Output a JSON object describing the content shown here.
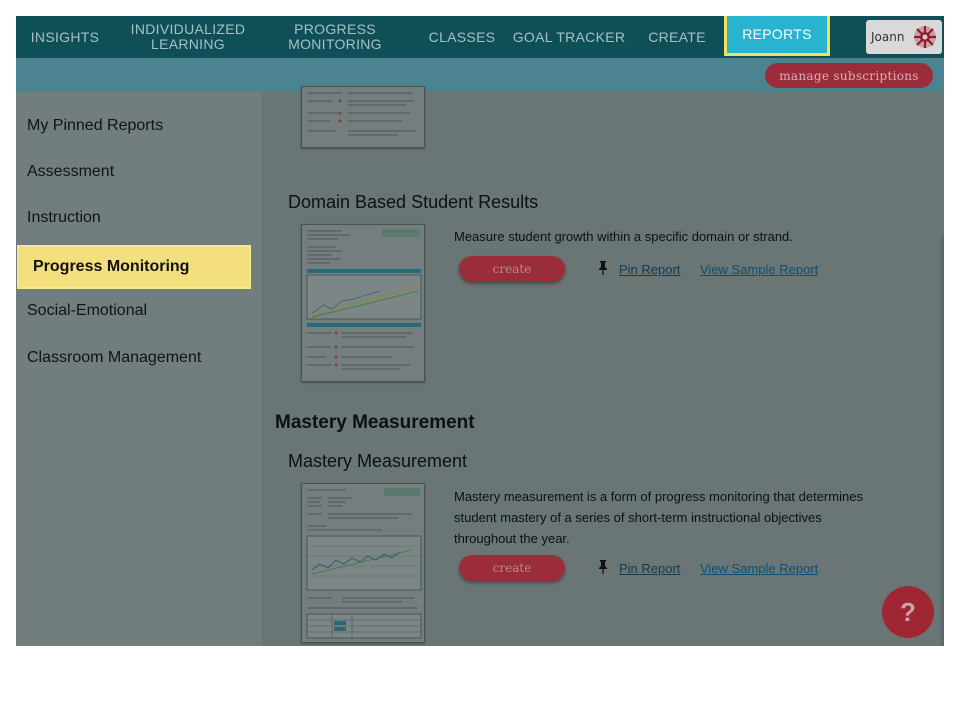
{
  "nav": {
    "items": [
      {
        "label": "INSIGHTS"
      },
      {
        "label_line1": "INDIVIDUALIZED",
        "label_line2": "LEARNING"
      },
      {
        "label_line1": "PROGRESS",
        "label_line2": "MONITORING"
      },
      {
        "label": "CLASSES"
      },
      {
        "label": "GOAL TRACKER"
      },
      {
        "label": "CREATE"
      },
      {
        "label": "REPORTS"
      }
    ],
    "user_name": "Joann"
  },
  "subbar": {
    "manage_label": "manage subscriptions"
  },
  "sidebar": {
    "items": [
      {
        "label": "My Pinned Reports"
      },
      {
        "label": "Assessment"
      },
      {
        "label": "Instruction"
      },
      {
        "label": "Progress Monitoring"
      },
      {
        "label": "Social-Emotional"
      },
      {
        "label": "Classroom Management"
      }
    ]
  },
  "reports": {
    "domain": {
      "title": "Domain Based Student Results",
      "description": "Measure student growth within a specific domain or strand.",
      "create_label": "create",
      "pin_label": "Pin Report",
      "sample_label": "View Sample Report"
    },
    "mastery_group": {
      "title": "Mastery Measurement"
    },
    "mastery": {
      "title": "Mastery Measurement",
      "description_line1": "Mastery measurement is a form of progress monitoring that determines",
      "description_line2": "student mastery of a series of short-term instructional objectives",
      "description_line3": "throughout the year.",
      "create_label": "create",
      "pin_label": "Pin Report",
      "sample_label": "View Sample Report"
    }
  },
  "help": {
    "label": "?"
  },
  "colors": {
    "nav_bg": "#0f4f58",
    "reports_tab": "#28b3cf",
    "highlight": "#f3df7d",
    "button_red": "#9b2d3a"
  }
}
